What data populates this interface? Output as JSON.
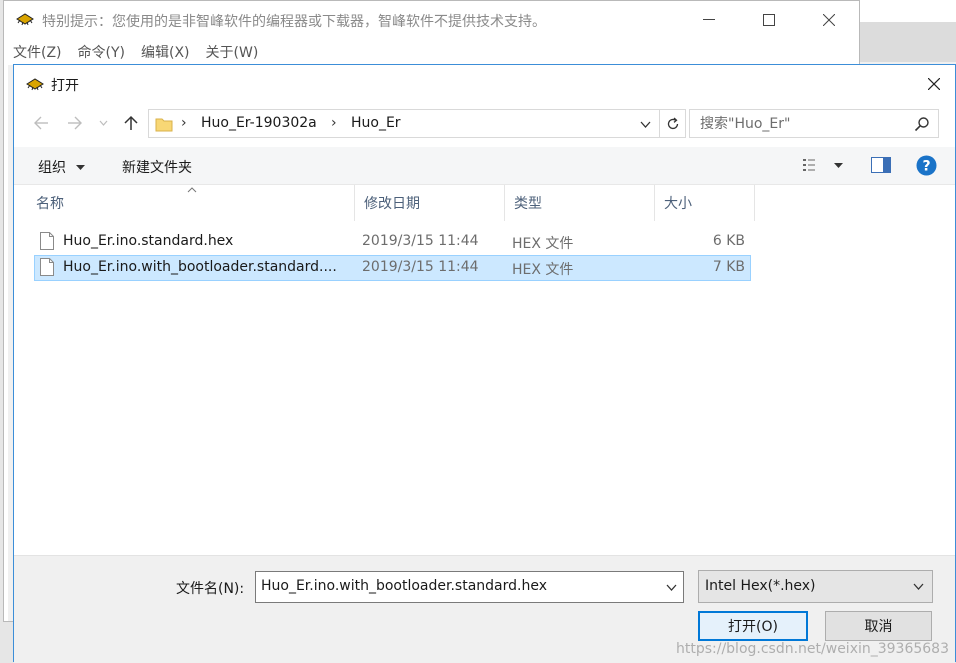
{
  "parent_window": {
    "title": "特别提示：您使用的是非智峰软件的编程器或下载器，智峰软件不提供技术支持。",
    "menu": [
      "文件(Z)",
      "命令(Y)",
      "编辑(X)",
      "关于(W)"
    ]
  },
  "dialog": {
    "title": "打开",
    "breadcrumb": [
      "Huo_Er-190302a",
      "Huo_Er"
    ],
    "search_placeholder": "搜索\"Huo_Er\"",
    "toolbar": {
      "organize": "组织",
      "new_folder": "新建文件夹"
    },
    "columns": {
      "name": "名称",
      "date": "修改日期",
      "type": "类型",
      "size": "大小"
    },
    "files": [
      {
        "name": "Huo_Er.ino.standard.hex",
        "date": "2019/3/15 11:44",
        "type": "HEX 文件",
        "size": "6 KB",
        "selected": false
      },
      {
        "name": "Huo_Er.ino.with_bootloader.standard....",
        "date": "2019/3/15 11:44",
        "type": "HEX 文件",
        "size": "7 KB",
        "selected": true
      }
    ],
    "filename_label": "文件名(N):",
    "filename_value": "Huo_Er.ino.with_bootloader.standard.hex",
    "filetype_value": "Intel Hex(*.hex)",
    "open_button": "打开(O)",
    "cancel_button": "取消"
  },
  "watermark": "https://blog.csdn.net/weixin_39365683",
  "colors": {
    "accent": "#0078d7",
    "selection": "#cce8ff",
    "help": "#1a73c8"
  }
}
